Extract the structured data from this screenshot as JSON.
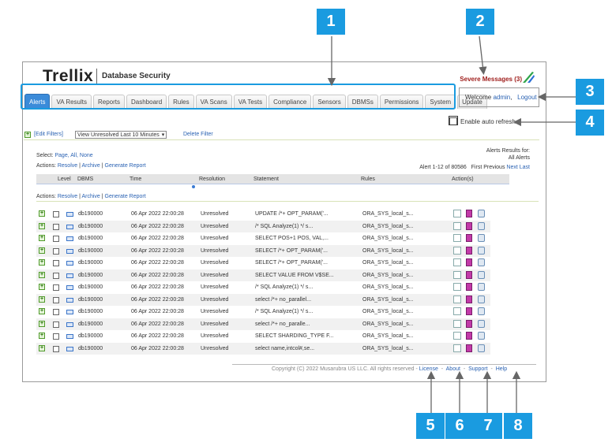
{
  "brand": {
    "logo": "Trellix",
    "product": "Database Security"
  },
  "severe_messages": "Severe Messages (3)",
  "tabs": [
    "Alerts",
    "VA Results",
    "Reports",
    "Dashboard",
    "Rules",
    "VA Scans",
    "VA Tests",
    "Compliance",
    "Sensors",
    "DBMSs",
    "Permissions",
    "System",
    "Update"
  ],
  "user": {
    "welcome": "Welcome",
    "name": "admin",
    "separator": ",",
    "logout": "Logout"
  },
  "auto_refresh": "Enable auto refresh",
  "filters": {
    "edit": "[Edit Filters]",
    "view": "View Unresolved Last 10 Minutes",
    "delete": "Delete Filter"
  },
  "select": {
    "label": "Select:",
    "page": "Page,",
    "all": "All,",
    "none": "None"
  },
  "actions": {
    "label": "Actions:",
    "resolve": "Resolve",
    "archive": "Archive",
    "report": "Generate Report"
  },
  "results_for": {
    "label": "Alerts Results for:",
    "value": "All Alerts"
  },
  "pager": {
    "range": "Alert 1-12 of 80586",
    "first": "First",
    "previous": "Previous",
    "next": "Next",
    "last": "Last"
  },
  "columns": {
    "level": "Level",
    "dbms": "DBMS",
    "time": "Time",
    "resolution": "Resolution",
    "statement": "Statement",
    "rules": "Rules",
    "actions": "Action(s)"
  },
  "rows": [
    {
      "dbms": "db190000",
      "time": "06 Apr 2022 22:00:28",
      "resolution": "Unresolved",
      "statement": "UPDATE /*+ OPT_PARAM('...",
      "rule": "ORA_SYS_local_s..."
    },
    {
      "dbms": "db190000",
      "time": "06 Apr 2022 22:00:28",
      "resolution": "Unresolved",
      "statement": "/* SQL Analyze(1) */ s...",
      "rule": "ORA_SYS_local_s..."
    },
    {
      "dbms": "db190000",
      "time": "06 Apr 2022 22:00:28",
      "resolution": "Unresolved",
      "statement": "SELECT POS+1 POS, VAL,...",
      "rule": "ORA_SYS_local_s..."
    },
    {
      "dbms": "db190000",
      "time": "06 Apr 2022 22:00:28",
      "resolution": "Unresolved",
      "statement": "SELECT /*+ OPT_PARAM('...",
      "rule": "ORA_SYS_local_s..."
    },
    {
      "dbms": "db190000",
      "time": "06 Apr 2022 22:00:28",
      "resolution": "Unresolved",
      "statement": "SELECT /*+ OPT_PARAM('...",
      "rule": "ORA_SYS_local_s..."
    },
    {
      "dbms": "db190000",
      "time": "06 Apr 2022 22:00:28",
      "resolution": "Unresolved",
      "statement": "SELECT VALUE FROM V$SE...",
      "rule": "ORA_SYS_local_s..."
    },
    {
      "dbms": "db190000",
      "time": "06 Apr 2022 22:00:28",
      "resolution": "Unresolved",
      "statement": "/* SQL Analyze(1) */ s...",
      "rule": "ORA_SYS_local_s..."
    },
    {
      "dbms": "db190000",
      "time": "06 Apr 2022 22:00:28",
      "resolution": "Unresolved",
      "statement": "select /*+ no_parallel...",
      "rule": "ORA_SYS_local_s..."
    },
    {
      "dbms": "db190000",
      "time": "06 Apr 2022 22:00:28",
      "resolution": "Unresolved",
      "statement": "/* SQL Analyze(1) */ s...",
      "rule": "ORA_SYS_local_s..."
    },
    {
      "dbms": "db190000",
      "time": "06 Apr 2022 22:00:28",
      "resolution": "Unresolved",
      "statement": "select /*+ no_paralle...",
      "rule": "ORA_SYS_local_s..."
    },
    {
      "dbms": "db190000",
      "time": "06 Apr 2022 22:00:28",
      "resolution": "Unresolved",
      "statement": "SELECT SHARDING_TYPE F...",
      "rule": "ORA_SYS_local_s..."
    },
    {
      "dbms": "db190000",
      "time": "06 Apr 2022 22:00:28",
      "resolution": "Unresolved",
      "statement": "select name,intcol#,se...",
      "rule": "ORA_SYS_local_s..."
    }
  ],
  "footer": {
    "copyright": "Copyright (C) 2022 Musarubra US LLC. All rights reserved",
    "license": "License",
    "about": "About",
    "support": "Support",
    "help": "Help"
  },
  "callouts": [
    "1",
    "2",
    "3",
    "4",
    "5",
    "6",
    "7",
    "8"
  ],
  "colors": {
    "callout": "#1a9be0",
    "active_tab": "#3b8bd9",
    "link": "#2a62b3",
    "severe": "#a0201e"
  }
}
